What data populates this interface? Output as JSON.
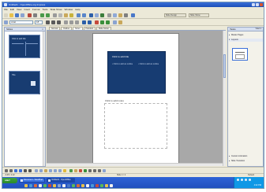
{
  "window": {
    "title": "Untitled1 - OpenOffice.org Impress"
  },
  "menu": [
    "File",
    "Edit",
    "View",
    "Insert",
    "Format",
    "Tools",
    "Slide Show",
    "Window",
    "Help"
  ],
  "toolbar2": {
    "font_name": "Arial",
    "font_size": "18",
    "slide_design_label": "Slide Design",
    "slide_show_label": "Slide Show"
  },
  "slides_pane": {
    "title": "Slides",
    "close": "×",
    "thumbnails": [
      {
        "number": "1",
        "title": "Click to add title"
      },
      {
        "number": "2",
        "title": "Title"
      }
    ]
  },
  "editor": {
    "tabs": [
      "Normal",
      "Outline",
      "Notes",
      "Handout",
      "Slide Sorter"
    ],
    "active_tab": "Notes",
    "slide_title": "Click to add title",
    "slide_text_left": "• Click to add an outline",
    "slide_text_right": "• Click to add an outline",
    "notes_placeholder": "Click to add notes"
  },
  "task_pane": {
    "title": "Tasks",
    "view_label": "View ▾",
    "sections": [
      {
        "label": "Master Pages",
        "expanded": false
      },
      {
        "label": "Layouts",
        "expanded": true
      },
      {
        "label": "Custom Animation",
        "expanded": false
      },
      {
        "label": "Slide Transition",
        "expanded": false
      }
    ]
  },
  "status_bar": {
    "position": "-3.45 / 4.22",
    "size": "0.00 x 0.00",
    "slide": "Slide 1 / 2",
    "layout": "Default"
  },
  "taskbar": {
    "start_label": "start",
    "tasks": [
      {
        "label": "Document - WordPad",
        "active": false
      },
      {
        "label": "Untitled1 - OpenOffice",
        "active": true
      }
    ],
    "clock": "4:32 PM"
  },
  "colors": {
    "slide_background": "#173c72",
    "taskbar": "#245edb",
    "start_button": "#3a9a3a"
  }
}
